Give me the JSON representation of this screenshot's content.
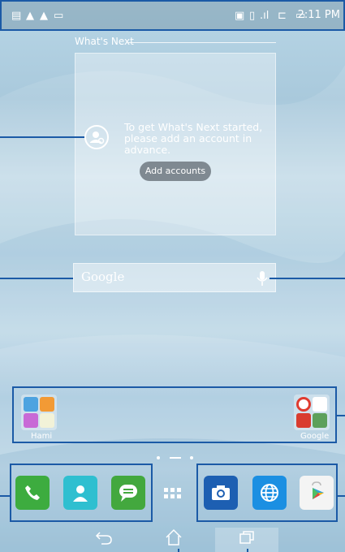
{
  "status_bar": {
    "time": "2:11 PM",
    "left_icons": [
      "sd-card-icon",
      "warning-icon",
      "warning-icon",
      "image-notification-icon"
    ],
    "right_icons": [
      "data-icon",
      "dual-sim-icon",
      "signal-icon",
      "wifi-icon",
      "battery-icon"
    ]
  },
  "whats_next": {
    "title": "What's Next",
    "message": "To get What's Next started, please add an account in advance.",
    "add_button": "Add accounts"
  },
  "search": {
    "placeholder": "Google"
  },
  "folders": [
    {
      "label": "Hami"
    },
    {
      "label": "Google"
    }
  ],
  "page_indicator": {
    "pages": 3,
    "current": 2
  },
  "dock": {
    "left_apps": [
      "phone",
      "contacts",
      "messages"
    ],
    "app_drawer": "all-apps",
    "right_apps": [
      "camera",
      "browser",
      "play-store"
    ]
  },
  "nav": [
    "back",
    "home",
    "recents"
  ],
  "colors": {
    "callout": "#1b5aa6"
  }
}
